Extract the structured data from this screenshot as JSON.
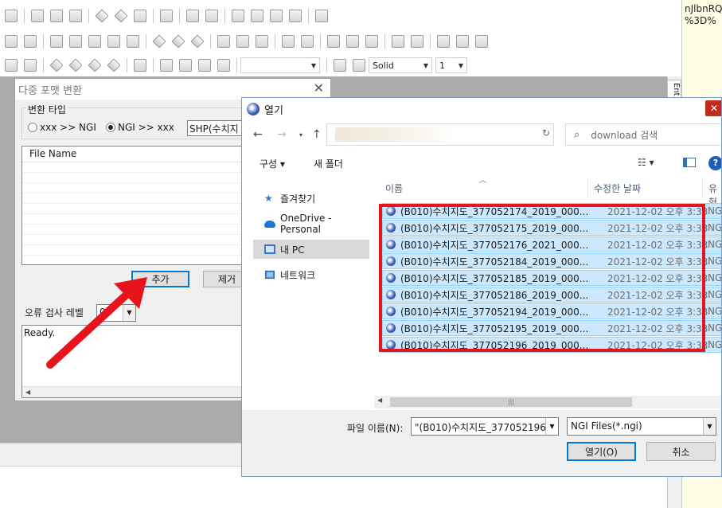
{
  "right_panel": {
    "lines": [
      "nJlbnRQ",
      "%3D%"
    ]
  },
  "right_tab": {
    "label": "Ent"
  },
  "toolbar": {
    "line_style": "Solid",
    "line_width": "1"
  },
  "convert_dialog": {
    "title": "다중 포맷 변환",
    "type_group_label": "변환 타입",
    "radio_xxx_to_ngi": "xxx >> NGI",
    "radio_ngi_to_xxx": "NGI >> xxx",
    "format_select": "SHP(수치지",
    "file_list_header": "File Name",
    "add_label": "추가",
    "remove_label": "제거",
    "error_level_label": "오류 검사 레벨",
    "error_level_value": "0",
    "log_text": "Ready."
  },
  "open_dialog": {
    "title": "열기",
    "search_placeholder": "download 검색",
    "organize_label": "구성 ▾",
    "new_folder_label": "새 폴더",
    "nav": {
      "favorites": "즐겨찾기",
      "onedrive": "OneDrive - Personal",
      "this_pc": "내 PC",
      "network": "네트워크"
    },
    "columns": {
      "name": "이름",
      "date": "수정한 날짜",
      "type": "유형"
    },
    "files": [
      {
        "name": "(B010)수치지도_377052174_2019_000...",
        "date": "2021-12-02 오후 3:33",
        "type": "NG"
      },
      {
        "name": "(B010)수치지도_377052175_2019_000...",
        "date": "2021-12-02 오후 3:33",
        "type": "NG"
      },
      {
        "name": "(B010)수치지도_377052176_2021_000...",
        "date": "2021-12-02 오후 3:33",
        "type": "NG"
      },
      {
        "name": "(B010)수치지도_377052184_2019_000...",
        "date": "2021-12-02 오후 3:33",
        "type": "NG"
      },
      {
        "name": "(B010)수치지도_377052185_2019_000...",
        "date": "2021-12-02 오후 3:33",
        "type": "NG"
      },
      {
        "name": "(B010)수치지도_377052186_2019_000...",
        "date": "2021-12-02 오후 3:33",
        "type": "NG"
      },
      {
        "name": "(B010)수치지도_377052194_2019_000...",
        "date": "2021-12-02 오후 3:33",
        "type": "NG"
      },
      {
        "name": "(B010)수치지도_377052195_2019_000...",
        "date": "2021-12-02 오후 3:33",
        "type": "NG"
      },
      {
        "name": "(B010)수치지도_377052196_2019_000...",
        "date": "2021-12-02 오후 3:33",
        "type": "NG"
      }
    ],
    "filename_label": "파일 이름(N):",
    "filename_value": "\"(B010)수치지도_377052196_",
    "filetype_value": "NGI Files(*.ngi)",
    "open_label": "열기(O)",
    "cancel_label": "취소"
  },
  "annotation_color": "#e8141c"
}
